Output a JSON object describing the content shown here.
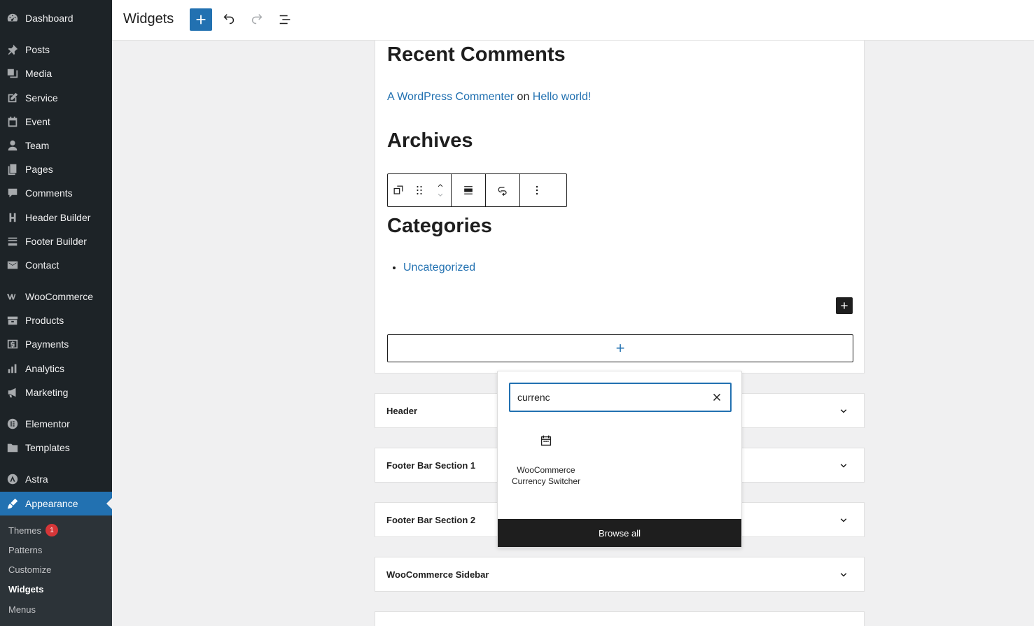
{
  "sidebar": {
    "items": [
      {
        "label": "Dashboard",
        "icon": "dashboard-icon"
      },
      {
        "label": "Posts",
        "icon": "pin-icon"
      },
      {
        "label": "Media",
        "icon": "media-icon"
      },
      {
        "label": "Service",
        "icon": "edit-icon"
      },
      {
        "label": "Event",
        "icon": "calendar-icon"
      },
      {
        "label": "Team",
        "icon": "user-icon"
      },
      {
        "label": "Pages",
        "icon": "pages-icon"
      },
      {
        "label": "Comments",
        "icon": "comment-icon"
      },
      {
        "label": "Header Builder",
        "icon": "header-icon"
      },
      {
        "label": "Footer Builder",
        "icon": "footer-icon"
      },
      {
        "label": "Contact",
        "icon": "mail-icon"
      },
      {
        "label": "WooCommerce",
        "icon": "woo-icon"
      },
      {
        "label": "Products",
        "icon": "archive-icon"
      },
      {
        "label": "Payments",
        "icon": "dollar-icon"
      },
      {
        "label": "Analytics",
        "icon": "chart-icon"
      },
      {
        "label": "Marketing",
        "icon": "megaphone-icon"
      },
      {
        "label": "Elementor",
        "icon": "elementor-icon"
      },
      {
        "label": "Templates",
        "icon": "folder-icon"
      },
      {
        "label": "Astra",
        "icon": "astra-icon"
      },
      {
        "label": "Appearance",
        "icon": "brush-icon"
      }
    ],
    "submenu": [
      {
        "label": "Themes",
        "badge": "1"
      },
      {
        "label": "Patterns"
      },
      {
        "label": "Customize"
      },
      {
        "label": "Widgets"
      },
      {
        "label": "Menus"
      }
    ]
  },
  "topbar": {
    "title": "Widgets"
  },
  "editor": {
    "recent_comments_heading": "Recent Comments",
    "comment_author": "A WordPress Commenter",
    "comment_on": "on",
    "comment_post": "Hello world!",
    "archives_heading": "Archives",
    "categories_heading": "Categories",
    "category_item": "Uncategorized",
    "appender_symbol": "+"
  },
  "panels": [
    {
      "title": "Header"
    },
    {
      "title": "Footer Bar Section 1"
    },
    {
      "title": "Footer Bar Section 2"
    },
    {
      "title": "WooCommerce Sidebar"
    }
  ],
  "inserter": {
    "search_value": "currenc",
    "result_label": "WooCommerce Currency Switcher",
    "browse_all_label": "Browse all"
  }
}
